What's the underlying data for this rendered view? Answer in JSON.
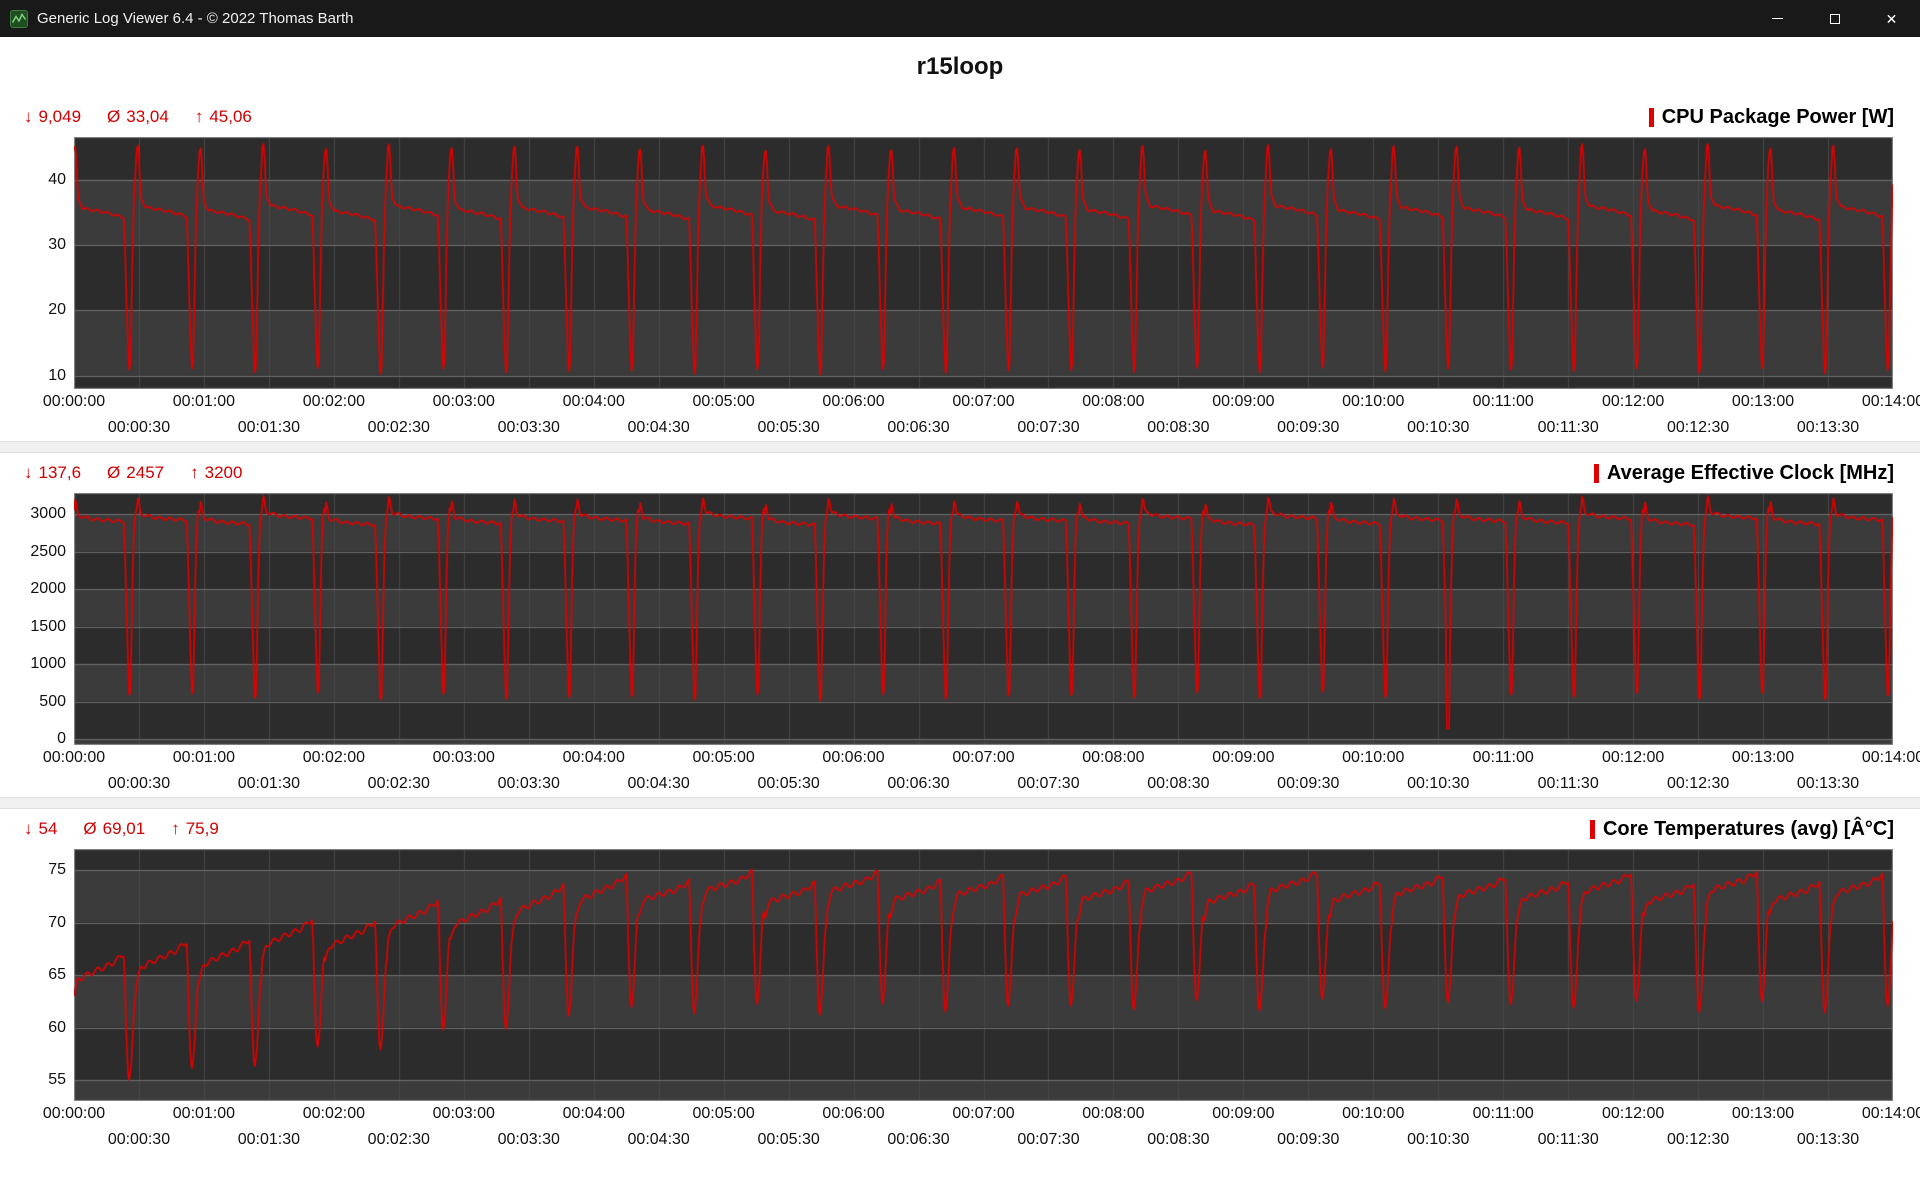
{
  "window": {
    "title": "Generic Log Viewer 6.4 - © 2022 Thomas Barth",
    "controls": {
      "minimize": "minimize",
      "maximize": "maximize",
      "close": "✕"
    }
  },
  "page_title": "r15loop",
  "x_axis": {
    "duration_s": 840,
    "tick_interval_s": 30,
    "row1_labels": [
      "00:00:00",
      "00:01:00",
      "00:02:00",
      "00:03:00",
      "00:04:00",
      "00:05:00",
      "00:06:00",
      "00:07:00",
      "00:08:00",
      "00:09:00",
      "00:10:00",
      "00:11:00",
      "00:12:00",
      "00:13:00",
      "00:14:00"
    ],
    "row2_labels": [
      "00:00:30",
      "00:01:30",
      "00:02:30",
      "00:03:30",
      "00:04:30",
      "00:05:30",
      "00:06:30",
      "00:07:30",
      "00:08:30",
      "00:09:30",
      "00:10:30",
      "00:11:30",
      "00:12:30",
      "00:13:30"
    ]
  },
  "chart_data": [
    {
      "type": "line",
      "name": "cpu-package-power",
      "title": "CPU Package Power [W]",
      "series_color": "#e10000",
      "stats": {
        "min_symbol": "↓",
        "min": "9,049",
        "avg_symbol": "Ø",
        "avg": "33,04",
        "max_symbol": "↑",
        "max": "45,06"
      },
      "stats_numeric": {
        "min": 9.049,
        "avg": 33.04,
        "max": 45.06
      },
      "unit": "W",
      "x_duration_s": 840,
      "cycle_period_s": 29,
      "y_min": 8,
      "y_max": 46.5,
      "y_ticks": [
        10,
        20,
        30,
        40
      ],
      "cycle_template": [
        [
          0,
          44.5
        ],
        [
          0.025,
          45.1
        ],
        [
          0.06,
          37.2
        ],
        [
          0.14,
          35.6
        ],
        [
          0.5,
          35.0
        ],
        [
          0.8,
          34.2
        ],
        [
          0.84,
          20
        ],
        [
          0.875,
          10.5
        ],
        [
          0.9,
          12
        ],
        [
          0.94,
          33
        ],
        [
          0.97,
          40
        ],
        [
          1,
          44.5
        ]
      ],
      "jitter": 0.5,
      "trend": {
        "amount": 0,
        "frac": 0
      }
    },
    {
      "type": "line",
      "name": "average-effective-clock",
      "title": "Average Effective Clock [MHz]",
      "series_color": "#e10000",
      "stats": {
        "min_symbol": "↓",
        "min": "137,6",
        "avg_symbol": "Ø",
        "avg": "2457",
        "max_symbol": "↑",
        "max": "3200"
      },
      "stats_numeric": {
        "min": 137.6,
        "avg": 2457,
        "max": 3200
      },
      "unit": "MHz",
      "x_duration_s": 840,
      "cycle_period_s": 29,
      "y_min": -80,
      "y_max": 3280,
      "y_ticks": [
        0,
        500,
        1000,
        1500,
        2000,
        2500,
        3000
      ],
      "cycle_template": [
        [
          0,
          3050
        ],
        [
          0.02,
          3200
        ],
        [
          0.06,
          2980
        ],
        [
          0.3,
          2930
        ],
        [
          0.8,
          2900
        ],
        [
          0.84,
          1600
        ],
        [
          0.875,
          560
        ],
        [
          0.9,
          620
        ],
        [
          0.94,
          2500
        ],
        [
          0.97,
          3000
        ],
        [
          1,
          3050
        ]
      ],
      "jitter": 55,
      "deep_dip": {
        "cycle": 21,
        "frac_start": 0.855,
        "frac_end": 0.905,
        "value": 140
      },
      "trend": {
        "amount": 0,
        "frac": 0
      }
    },
    {
      "type": "line",
      "name": "core-temperatures-avg",
      "title": "Core Temperatures (avg) [Â°C]",
      "series_color": "#e10000",
      "stats": {
        "min_symbol": "↓",
        "min": "54",
        "avg_symbol": "Ø",
        "avg": "69,01",
        "max_symbol": "↑",
        "max": "75,9"
      },
      "stats_numeric": {
        "min": 54,
        "avg": 69.01,
        "max": 75.9
      },
      "unit": "°C",
      "x_duration_s": 840,
      "cycle_period_s": 29,
      "y_min": 53,
      "y_max": 77,
      "y_ticks": [
        55,
        60,
        65,
        70,
        75
      ],
      "cycle_template": [
        [
          0,
          71
        ],
        [
          0.06,
          72.5
        ],
        [
          0.3,
          73
        ],
        [
          0.6,
          73.5
        ],
        [
          0.8,
          74.3
        ],
        [
          0.835,
          66
        ],
        [
          0.87,
          61.5
        ],
        [
          0.91,
          63.5
        ],
        [
          0.96,
          69.5
        ],
        [
          1,
          71
        ]
      ],
      "jitter": 0.7,
      "trend": {
        "amount": -8,
        "frac": 0.3
      }
    }
  ]
}
